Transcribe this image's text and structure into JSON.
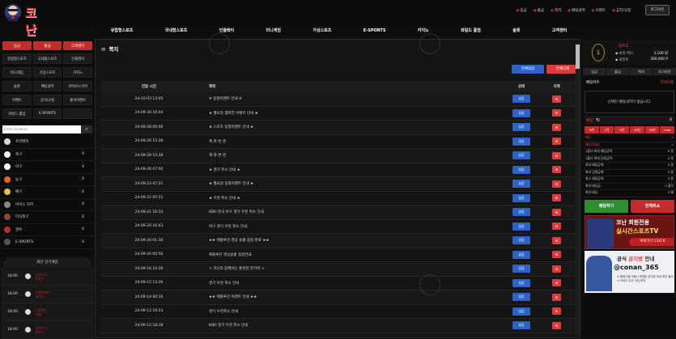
{
  "header": {
    "logo_text": "코난",
    "top_nav": [
      {
        "icon": "deposit-icon",
        "label": "입금"
      },
      {
        "icon": "withdraw-icon",
        "label": "출금"
      },
      {
        "icon": "note-icon",
        "label": "쪽지"
      },
      {
        "icon": "bet-history-icon",
        "label": "배팅내역"
      },
      {
        "icon": "event-icon",
        "label": "이벤트"
      },
      {
        "icon": "notice-icon",
        "label": "공지/규정"
      }
    ],
    "logout_label": "로그아웃"
  },
  "main_nav": [
    "유럽형스포츠",
    "국내형스포츠",
    "인플레이",
    "미니게임",
    "가상스포츠",
    "E-SPORTS",
    "카지노",
    "와일드 홀덤",
    "슬롯",
    "고객센터"
  ],
  "left_sidebar": {
    "top_buttons": [
      "입금",
      "출금",
      "고객센터"
    ],
    "grid": [
      [
        "유럽형스포츠",
        "국내형스포츠",
        "인플레이"
      ],
      [
        "미니게임",
        "가상스포츠",
        "카지노"
      ],
      [
        "슬롯",
        "배팅내역",
        "라이브스코어"
      ],
      [
        "이벤트",
        "공지/규정",
        "출석이벤트"
      ],
      [
        "와일드 홀덤",
        "E-SPORTS",
        ""
      ]
    ],
    "search_placeholder": "Enter keyword",
    "sports": [
      {
        "name": "프리매치",
        "count": "",
        "color": "#d9d9d9"
      },
      {
        "name": "축구",
        "count": "0",
        "color": "#f0f0f0"
      },
      {
        "name": "야구",
        "count": "0",
        "color": "#ffffff"
      },
      {
        "name": "농구",
        "count": "0",
        "color": "#e06a1c"
      },
      {
        "name": "배구",
        "count": "0",
        "color": "#e8c040"
      },
      {
        "name": "아이스 하키",
        "count": "0",
        "color": "#888888"
      },
      {
        "name": "미식축구",
        "count": "0",
        "color": "#8b4a2a"
      },
      {
        "name": "권투",
        "count": "0",
        "color": "#c22a2a"
      },
      {
        "name": "E-SPORTS",
        "count": "0",
        "color": "#555555"
      }
    ],
    "popular_title": "최신 인기게임",
    "popular": [
      {
        "time": "18:00",
        "teams": [
          "미네소타",
          "트윈스"
        ]
      },
      {
        "time": "18:00",
        "teams": [
          "토론토블루",
          "제이스"
        ]
      },
      {
        "time": "18:00",
        "teams": [
          "오클랜드",
          "애슬"
        ]
      },
      {
        "time": "18:00",
        "teams": [
          "플로리다",
          "말린스"
        ]
      }
    ]
  },
  "main": {
    "title": "쪽지",
    "btn_delete_selected": "전체읽음",
    "btn_delete_all": "전체삭제",
    "columns": [
      "전달 시간",
      "제목",
      "상태",
      "삭제"
    ],
    "rows": [
      {
        "date": "24-10-03 13:05",
        "title": "※ 동절이벤트 안내 ※",
        "status": "읽음"
      },
      {
        "date": "24-09-30 16:04",
        "title": "★ 월요일 챔피언 이벤트 안내 ★",
        "status": "읽음"
      },
      {
        "date": "24-09-28 00:00",
        "title": "★ 스포츠 동절이벤트 안내 ★",
        "status": "읽음"
      },
      {
        "date": "24-09-26 15:38",
        "title": "계 좌 변 경",
        "status": "읽음"
      },
      {
        "date": "24-09-26 15:38",
        "title": "계 좌 변 경",
        "status": "읽음"
      },
      {
        "date": "24-09-26 07:00",
        "title": "★ 경기 취소 안내 ★",
        "status": "읽음"
      },
      {
        "date": "24-09-23 07:21",
        "title": "★ 월요일 동절이벤트 안내 ★",
        "status": "읽음"
      },
      {
        "date": "24-09-22 05:51",
        "title": "★ 우천 취소 안내 ★",
        "status": "읽음"
      },
      {
        "date": "24-09-21 16:33",
        "title": "KBO 한국 야구 경기 우천 취소 안내",
        "status": "읽음"
      },
      {
        "date": "24-09-20 16:43",
        "title": "야구 경기 우천 취소 안내",
        "status": "읽음"
      },
      {
        "date": "24-09-20 01:30",
        "title": "★★ 에볼루션 영상 송출 점검 완료 ★★",
        "status": "읽음"
      },
      {
        "date": "24-09-20 00:56",
        "title": "에볼루션 영상송출 점검안내",
        "status": "읽음"
      },
      {
        "date": "24-09-16 10:39",
        "title": "< 코난과 함께하는 풍성한 한가위 >",
        "status": "읽음"
      },
      {
        "date": "24-09-15 13:36",
        "title": "경기 우천 취소 안내",
        "status": "읽음"
      },
      {
        "date": "24-09-14 00:10",
        "title": "★★ 에볼루션 이벤트 안내 ★★",
        "status": "읽음"
      },
      {
        "date": "24-09-13 16:23",
        "title": "경기 우천취소 안내",
        "status": "읽음"
      },
      {
        "date": "24-09-12 18:18",
        "title": "KBO 경기 우천 취소 안내",
        "status": "읽음"
      }
    ]
  },
  "right_sidebar": {
    "user_level": "1",
    "user_name": "넷프리",
    "money_label": "보유 머니",
    "money_value": "3,100 원",
    "point_label": "포인트",
    "point_value": "300,000 P",
    "tabs": [
      "입금",
      "출금",
      "쪽지",
      "로그아웃"
    ],
    "slip_title": "배팅카트",
    "slip_clear": "전체삭제",
    "no_selection": "선택된 배팅내역이 없습니다.",
    "bet_label": "배팅",
    "bet_value": "0",
    "quick_amounts": [
      "5천",
      "1만",
      "5만",
      "10만",
      "50만",
      "max"
    ],
    "info_rows": [
      {
        "label": "배당",
        "value": "0",
        "red": true
      },
      {
        "label": "예상당첨금",
        "value": "0",
        "red": true
      },
      {
        "label": "1폴더 최대 배팅금액:",
        "value": "0 원",
        "red": false
      },
      {
        "label": "1폴더 최대 당첨금액:",
        "value": "0 원",
        "red": false
      },
      {
        "label": "최대 배팅금액:",
        "value": "0 원",
        "red": false
      },
      {
        "label": "최대 당첨금액:",
        "value": "0 원",
        "red": false
      },
      {
        "label": "최소 배팅금액:",
        "value": "0 원",
        "red": false
      },
      {
        "label": "최대 배당금:",
        "value": "0 폴더",
        "red": false
      },
      {
        "label": "최대 배당:",
        "value": "0 배",
        "red": false
      }
    ],
    "bet_button": "배팅하기",
    "cancel_button": "전체취소",
    "banner1": {
      "line1": "코난 회원전용",
      "line2": "실시간스포츠TV",
      "cta": "바로가기 CLICK"
    },
    "banner2": {
      "line1a": "공식 ",
      "line1b": "공지방",
      "line1c": " 안내",
      "line2": "@conan_365",
      "line3": "※ 텔레그램 이용시 변경된 공지방 안내 확인 필요 ※ 아이디 신규 가입 문의"
    }
  },
  "colors": {
    "accent_red": "#e13a3a",
    "accent_blue": "#2a64c8",
    "background": "#0e0e0e"
  }
}
